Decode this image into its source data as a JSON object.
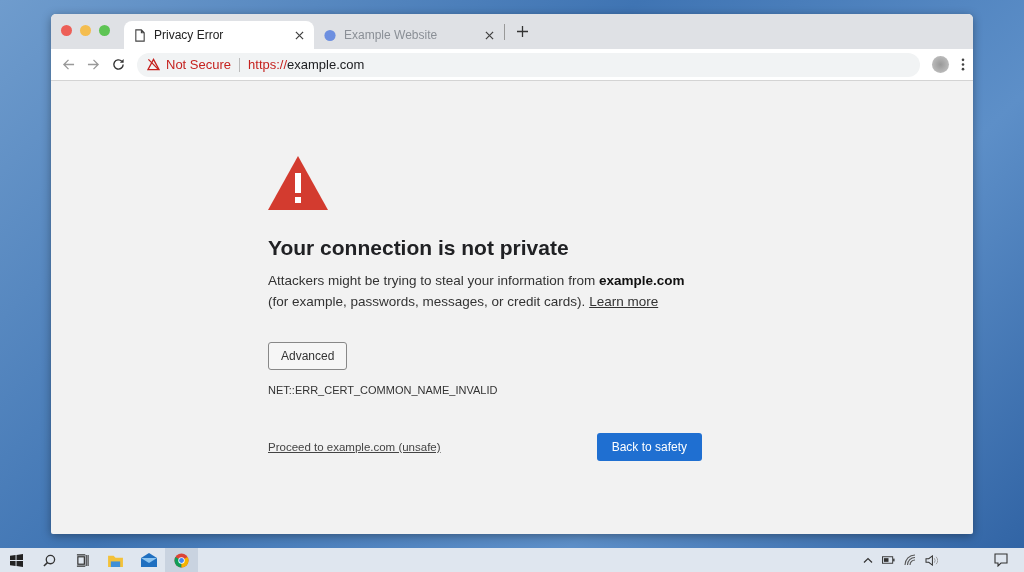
{
  "tabs": [
    {
      "title": "Privacy Error",
      "selected": true,
      "kind": "page"
    },
    {
      "title": "Example Website",
      "selected": false,
      "kind": "site"
    }
  ],
  "address_bar": {
    "security": "Not Secure",
    "scheme": "https://",
    "host": "example.com"
  },
  "error": {
    "title": "Your connection is not private",
    "message": "Attackers might be trying to steal your information from **example.com** (for example, passwords, messages, or credit cards).",
    "learn_more": "Learn more",
    "advanced": "Advanced",
    "code": "NET::ERR_CERT_COMMON_NAME_INVALID",
    "proceed": "Proceed to example.com (unsafe)",
    "back": "Back to safety"
  },
  "taskbar": {
    "apps": [
      {
        "kind": "start",
        "selected": false
      },
      {
        "kind": "search",
        "selected": false
      },
      {
        "kind": "taskview",
        "selected": false
      },
      {
        "kind": "files",
        "selected": false
      },
      {
        "kind": "mail",
        "selected": false
      },
      {
        "kind": "chrome",
        "selected": true
      }
    ]
  }
}
